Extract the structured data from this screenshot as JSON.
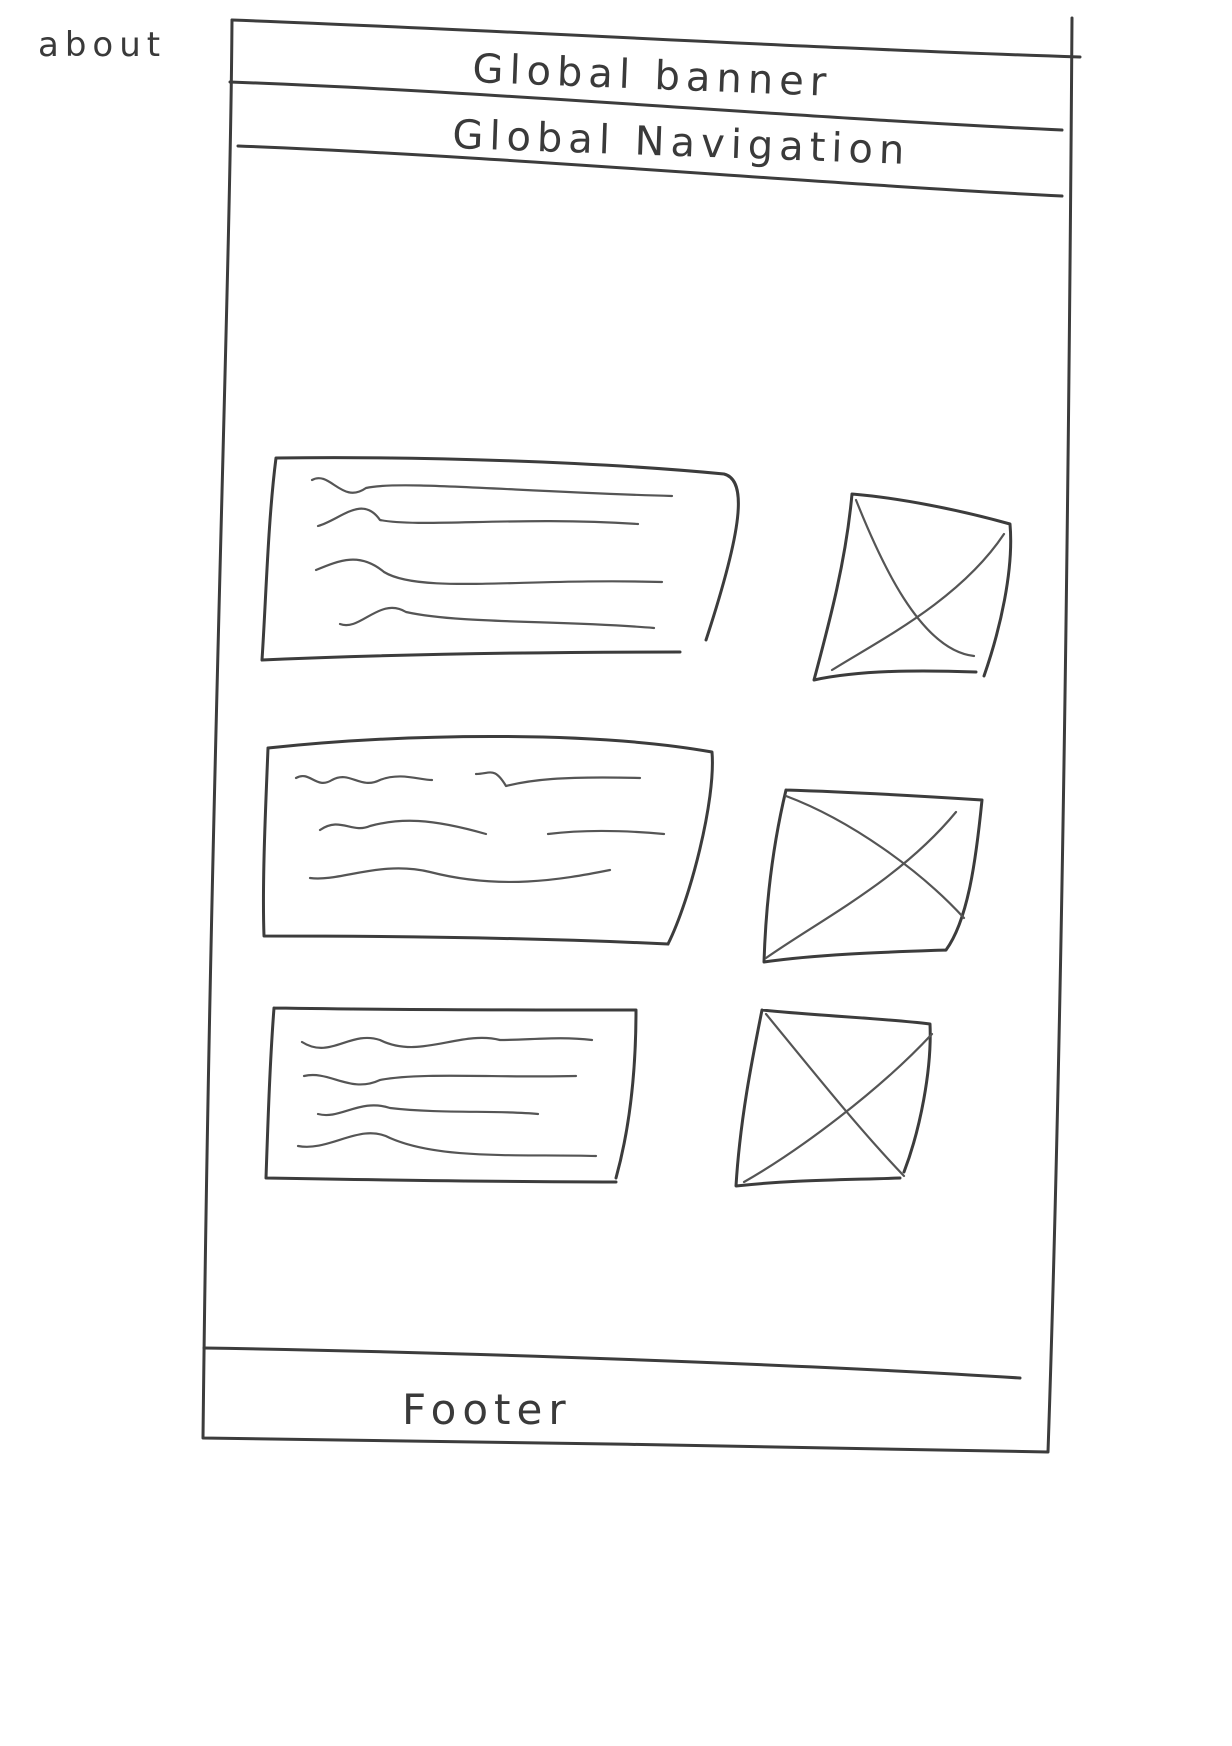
{
  "page_label": "about",
  "global_banner": {
    "label": "Global banner"
  },
  "global_navigation": {
    "label": "Global Navigation"
  },
  "content_rows": [
    {
      "text_block": {
        "lines": 4
      },
      "image_placeholder": {
        "icon": "crossed-box-image-icon"
      }
    },
    {
      "text_block": {
        "lines": 3
      },
      "image_placeholder": {
        "icon": "crossed-box-image-icon"
      }
    },
    {
      "text_block": {
        "lines": 4
      },
      "image_placeholder": {
        "icon": "crossed-box-image-icon"
      }
    }
  ],
  "footer": {
    "label": "Footer"
  },
  "colors": {
    "ink": "#3c3c3c",
    "paper": "#ffffff"
  }
}
